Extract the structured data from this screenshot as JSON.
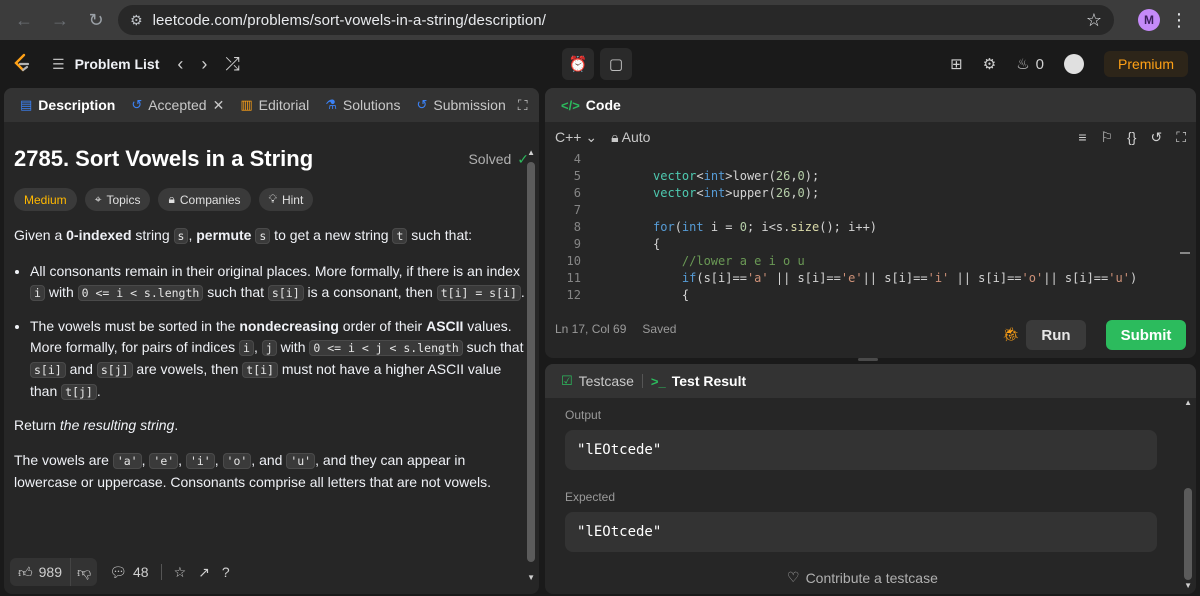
{
  "browser": {
    "url": "leetcode.com/problems/sort-vowels-in-a-string/description/",
    "profile_initial": "M"
  },
  "topbar": {
    "problem_list_label": "Problem List",
    "streak_count": "0",
    "premium_label": "Premium"
  },
  "left_tabs": [
    {
      "label": "Description"
    },
    {
      "label": "Accepted"
    },
    {
      "label": "Editorial"
    },
    {
      "label": "Solutions"
    },
    {
      "label": "Submission"
    }
  ],
  "problem": {
    "title": "2785. Sort Vowels in a String",
    "status": "Solved",
    "difficulty": "Medium",
    "chips": [
      "Topics",
      "Companies",
      "Hint"
    ],
    "intro": {
      "t1": "Given a ",
      "b1": "0-indexed",
      "t2": " string ",
      "c1": "s",
      "t3": ", ",
      "b2": "permute",
      "t4": " ",
      "c2": "s",
      "t5": " to get a new string ",
      "c3": "t",
      "t6": " such that:"
    },
    "bullet1": {
      "t1": "All consonants remain in their original places. More formally, if there is an index ",
      "c1": "i",
      "t2": " with ",
      "c2": "0 <= i < s.length",
      "t3": " such that ",
      "c3": "s[i]",
      "t4": " is a consonant, then ",
      "c4": "t[i] = s[i]",
      "t5": "."
    },
    "bullet2": {
      "t1": "The vowels must be sorted in the ",
      "b1": "nondecreasing",
      "t2": " order of their ",
      "b2": "ASCII",
      "t3": " values. More formally, for pairs of indices ",
      "c1": "i",
      "t4": ", ",
      "c2": "j",
      "t5": " with ",
      "c3": "0 <= i < j < s.length",
      "t6": " such that ",
      "c4": "s[i]",
      "t7": " and ",
      "c5": "s[j]",
      "t8": " are vowels, then ",
      "c6": "t[i]",
      "t9": " must not have a higher ASCII value than ",
      "c7": "t[j]",
      "t10": "."
    },
    "return": {
      "t1": "Return ",
      "i1": "the resulting string",
      "t2": "."
    },
    "vowels": {
      "t1": "The vowels are ",
      "c1": "'a'",
      "c2": "'e'",
      "c3": "'i'",
      "c4": "'o'",
      "c5": "'u'",
      "t2": ", and they can appear in lowercase or uppercase. Consonants comprise all letters that are not vowels."
    }
  },
  "footer": {
    "likes": "989",
    "comments": "48"
  },
  "code_panel": {
    "title": "Code",
    "language": "C++",
    "mode": "Auto",
    "status_position": "Ln 17, Col 69",
    "status_saved": "Saved",
    "run_label": "Run",
    "submit_label": "Submit",
    "line_numbers": [
      "4",
      "5",
      "6",
      "7",
      "8",
      "9",
      "10",
      "11",
      "12"
    ]
  },
  "result_panel": {
    "testcase_tab": "Testcase",
    "result_tab": "Test Result",
    "output_label": "Output",
    "output_value": "\"lEOtcede\"",
    "expected_label": "Expected",
    "expected_value": "\"lEOtcede\"",
    "contribute_label": "Contribute a testcase"
  }
}
